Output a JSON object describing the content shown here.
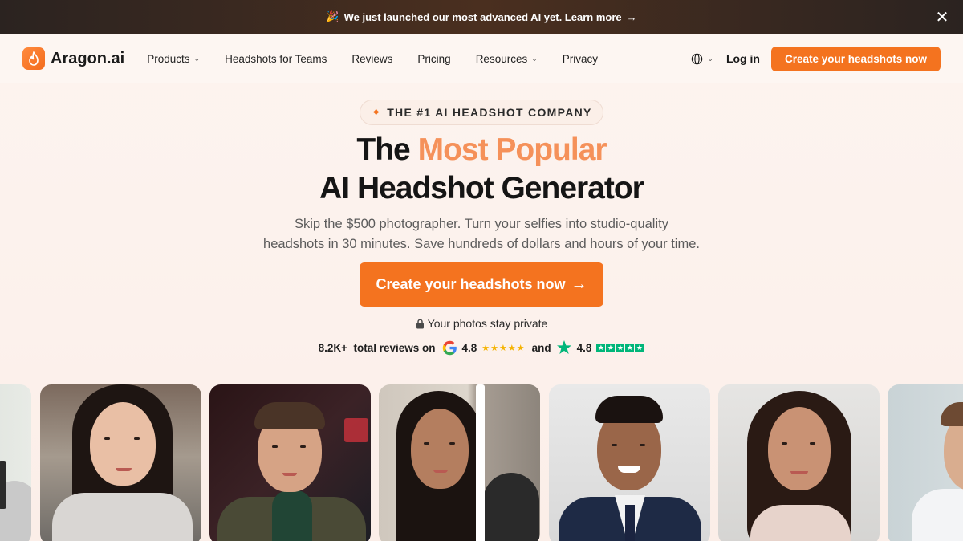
{
  "announcement": {
    "emoji": "🎉",
    "text": "We just launched our most advanced AI yet. Learn more",
    "arrow": "→",
    "close": "✕"
  },
  "nav": {
    "logo_text": "Aragon.ai",
    "links": [
      {
        "label": "Products",
        "dropdown": true
      },
      {
        "label": "Headshots for Teams",
        "dropdown": false
      },
      {
        "label": "Reviews",
        "dropdown": false
      },
      {
        "label": "Pricing",
        "dropdown": false
      },
      {
        "label": "Resources",
        "dropdown": true
      },
      {
        "label": "Privacy",
        "dropdown": false
      }
    ],
    "login": "Log in",
    "cta": "Create your headshots now"
  },
  "hero": {
    "badge": "THE #1 AI HEADSHOT COMPANY",
    "title_part1": "The ",
    "title_accent": "Most Popular",
    "title_line2": "AI Headshot Generator",
    "subtitle_line1": "Skip the $500 photographer. Turn your selfies into studio-quality",
    "subtitle_line2": "headshots in 30 minutes. Save hundreds of dollars and hours of your time.",
    "cta": "Create your headshots now",
    "cta_arrow": "→",
    "privacy": "Your photos stay private",
    "reviews_text": "8.2K+  total reviews on",
    "google_rating": "4.8",
    "google_stars": "★★★★★",
    "and": "and",
    "trustpilot_rating": "4.8"
  },
  "colors": {
    "accent": "#f4731f",
    "accent_light": "#f5915a",
    "trustpilot": "#00b67a",
    "star_yellow": "#f5b301"
  },
  "photos": [
    {
      "name": "photo-selfie-partial"
    },
    {
      "name": "photo-woman-street-selfie"
    },
    {
      "name": "photo-man-neon-bar"
    },
    {
      "name": "photo-woman-before-after"
    },
    {
      "name": "photo-man-suit-headshot"
    },
    {
      "name": "photo-woman-studio-headshot"
    },
    {
      "name": "photo-man-partial"
    }
  ]
}
